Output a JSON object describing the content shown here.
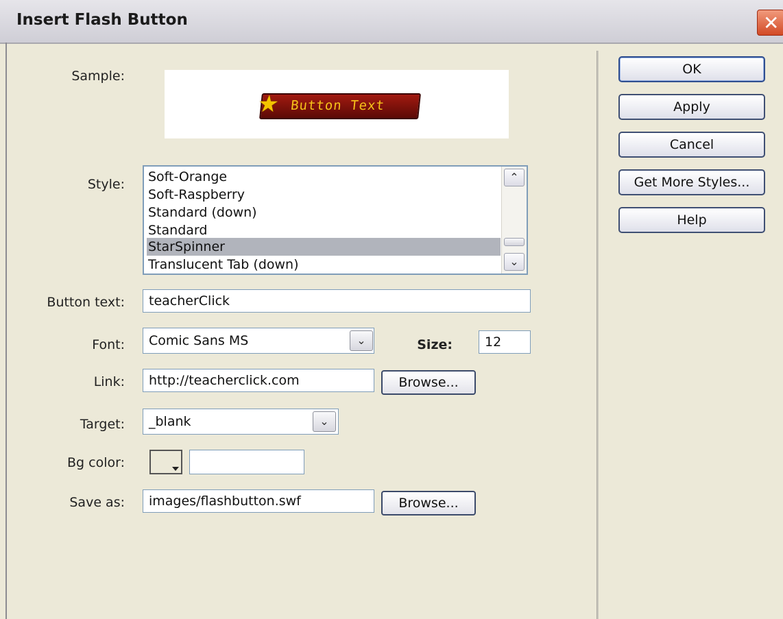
{
  "window": {
    "title": "Insert Flash Button",
    "close_glyph": "✕"
  },
  "sample": {
    "label": "Sample:",
    "preview_text": "Button Text",
    "preview_icon": "star-icon"
  },
  "style": {
    "label": "Style:",
    "items": [
      "Soft-Orange",
      "Soft-Raspberry",
      "Standard (down)",
      "Standard",
      "StarSpinner",
      "Translucent Tab (down)"
    ],
    "selected": "StarSpinner"
  },
  "button_text": {
    "label": "Button text:",
    "value": "teacherClick"
  },
  "font": {
    "label": "Font:",
    "value": "Comic Sans MS"
  },
  "size": {
    "label": "Size:",
    "value": "12"
  },
  "link": {
    "label": "Link:",
    "value": "http://teacherclick.com",
    "browse_label": "Browse..."
  },
  "target": {
    "label": "Target:",
    "value": "_blank"
  },
  "bg_color": {
    "label": "Bg color:",
    "value": ""
  },
  "save_as": {
    "label": "Save as:",
    "value": "images/flashbutton.swf",
    "browse_label": "Browse..."
  },
  "buttons": {
    "ok": "OK",
    "apply": "Apply",
    "cancel": "Cancel",
    "get_more_styles": "Get More Styles...",
    "help": "Help"
  },
  "colors": {
    "dialog_bg": "#ece9d8",
    "selection": "#b1b4bc",
    "sample_red": "#a11a10",
    "sample_gold": "#f6c21a"
  }
}
